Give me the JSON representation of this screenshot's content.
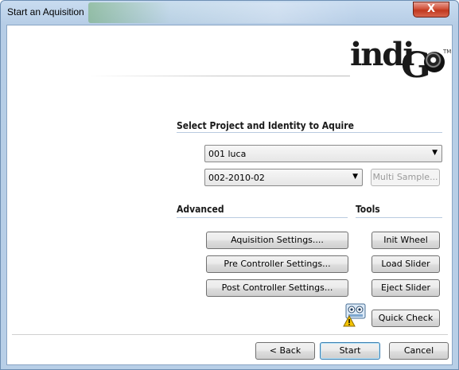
{
  "window": {
    "title": "Start an Aquisition",
    "close_glyph": "X"
  },
  "logo": {
    "text_main": "indi",
    "text_g": "G",
    "tm": "TM"
  },
  "project_section": {
    "title": "Select Project and Identity to Aquire",
    "project_select": {
      "value": "001 luca"
    },
    "identity_select": {
      "value": "002-2010-02"
    },
    "multi_sample_label": "Multi Sample..."
  },
  "advanced": {
    "title": "Advanced",
    "buttons": [
      "Aquisition Settings....",
      "Pre Controller Settings...",
      "Post Controller Settings..."
    ]
  },
  "tools": {
    "title": "Tools",
    "buttons": [
      "Init Wheel",
      "Load Slider",
      "Eject Slider",
      "Quick Check"
    ]
  },
  "footer": {
    "back_label": "< Back",
    "start_label": "Start",
    "cancel_label": "Cancel"
  },
  "icons": {
    "close": "close-icon",
    "dropdown": "chevron-down-icon",
    "warning": "warning-camera-icon"
  }
}
